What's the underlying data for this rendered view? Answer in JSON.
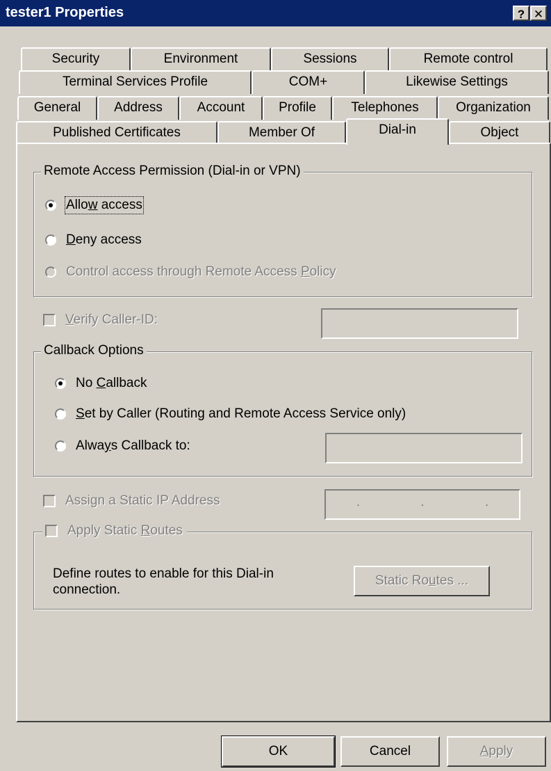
{
  "window": {
    "title": "tester1 Properties",
    "help_label": "?",
    "close_label": "✕"
  },
  "tabs": {
    "row1": [
      "Security",
      "Environment",
      "Sessions",
      "Remote control"
    ],
    "row2": [
      "Terminal Services Profile",
      "COM+",
      "Likewise Settings"
    ],
    "row3": [
      "General",
      "Address",
      "Account",
      "Profile",
      "Telephones",
      "Organization"
    ],
    "row4": [
      "Published Certificates",
      "Member Of",
      "Dial-in",
      "Object"
    ],
    "selected": "Dial-in"
  },
  "remote_access": {
    "label": "Remote Access Permission (Dial-in or VPN)",
    "allow_pre": "Allo",
    "allow_key": "w",
    "allow_post": " access",
    "deny_pre": "",
    "deny_key": "D",
    "deny_post": "eny access",
    "policy_pre": "Control access through Remote Access ",
    "policy_key": "P",
    "policy_post": "olicy",
    "selected": "allow"
  },
  "verify_caller": {
    "pre": "",
    "key": "V",
    "post": "erify Caller-ID:",
    "checked": false,
    "enabled": false,
    "value": ""
  },
  "callback": {
    "label": "Callback Options",
    "none_pre": "No ",
    "none_key": "C",
    "none_post": "allback",
    "caller_pre": "",
    "caller_key": "S",
    "caller_post": "et by Caller (Routing and Remote Access Service only)",
    "always_pre": "Alwa",
    "always_key": "y",
    "always_post": "s Callback to:",
    "always_value": "",
    "selected": "none"
  },
  "static_ip": {
    "label": "Assign a Static IP Address",
    "checked": false,
    "enabled": false,
    "dots": [
      ".",
      ".",
      "."
    ]
  },
  "static_routes": {
    "pre": "Apply Static ",
    "key": "R",
    "post": "outes",
    "checked": false,
    "description": "Define routes to enable for this Dial-in connection.",
    "button_pre": "Static Ro",
    "button_key": "u",
    "button_post": "tes ..."
  },
  "buttons": {
    "ok": "OK",
    "cancel": "Cancel",
    "apply_key": "A",
    "apply_post": "pply"
  }
}
